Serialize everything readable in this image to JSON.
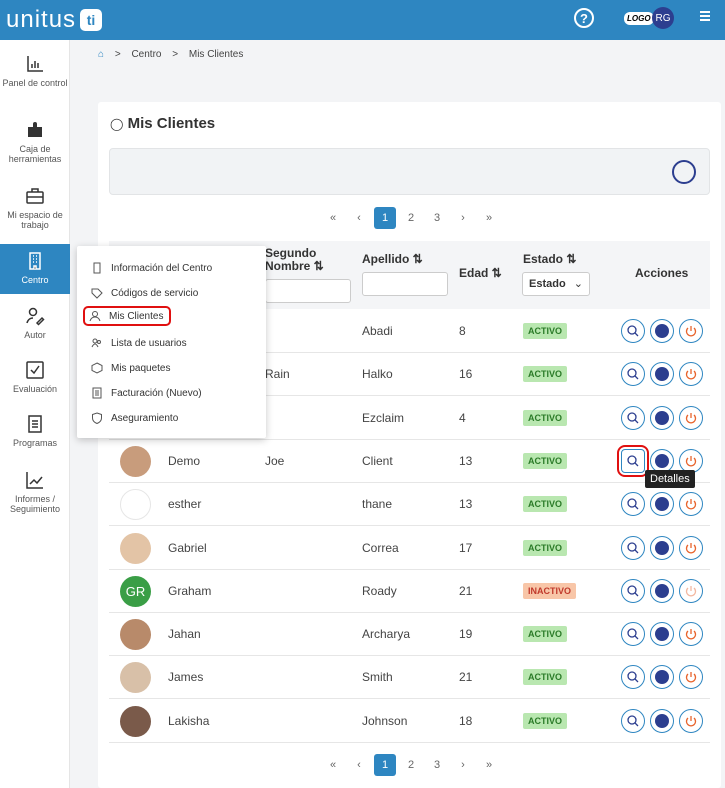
{
  "brand": {
    "name": "unitus",
    "badge": "ti"
  },
  "topbar": {
    "help": "?",
    "logo_label": "LOGO",
    "user_initials": "RG"
  },
  "sidebar": {
    "items": [
      {
        "label": "Panel de control",
        "icon": "chart-icon"
      },
      {
        "label": "Caja de herramientas",
        "icon": "puzzle-icon"
      },
      {
        "label": "Mi espacio de trabajo",
        "icon": "briefcase-icon"
      },
      {
        "label": "Centro",
        "icon": "building-icon",
        "active": true
      },
      {
        "label": "Autor",
        "icon": "author-icon"
      },
      {
        "label": "Evaluación",
        "icon": "check-icon"
      },
      {
        "label": "Programas",
        "icon": "document-icon"
      },
      {
        "label": "Informes / Seguimiento",
        "icon": "trend-icon"
      }
    ]
  },
  "breadcrumb": {
    "home": "⌂",
    "sep": ">",
    "items": [
      "Centro",
      "Mis Clientes"
    ]
  },
  "page": {
    "title": "Mis Clientes"
  },
  "pagination": {
    "first": "«",
    "prev": "‹",
    "pages": [
      "1",
      "2",
      "3"
    ],
    "next": "›",
    "last": "»",
    "current": "1"
  },
  "table": {
    "headers": {
      "middle_name": "Segundo Nombre ⇅",
      "last_name": "Apellido ⇅",
      "age": "Edad ⇅",
      "status": "Estado ⇅",
      "status_filter": "Estado",
      "actions": "Acciones"
    },
    "rows": [
      {
        "first": "",
        "middle": "",
        "last": "Abadi",
        "age": "8",
        "status": "ACTIVO",
        "active": true
      },
      {
        "first": "",
        "middle": "Rain",
        "last": "Halko",
        "age": "16",
        "status": "ACTIVO",
        "active": true
      },
      {
        "first": "",
        "middle": "",
        "last": "Ezclaim",
        "age": "4",
        "status": "ACTIVO",
        "active": true
      },
      {
        "first": "Demo",
        "middle": "Joe",
        "last": "Client",
        "age": "13",
        "status": "ACTIVO",
        "active": true
      },
      {
        "first": "esther",
        "middle": "",
        "last": "thane",
        "age": "13",
        "status": "ACTIVO",
        "active": true
      },
      {
        "first": "Gabriel",
        "middle": "",
        "last": "Correa",
        "age": "17",
        "status": "ACTIVO",
        "active": true
      },
      {
        "first": "Graham",
        "middle": "",
        "last": "Roady",
        "age": "21",
        "status": "INACTIVO",
        "active": false,
        "initials": "GR"
      },
      {
        "first": "Jahan",
        "middle": "",
        "last": "Archarya",
        "age": "19",
        "status": "ACTIVO",
        "active": true
      },
      {
        "first": "James",
        "middle": "",
        "last": "Smith",
        "age": "21",
        "status": "ACTIVO",
        "active": true
      },
      {
        "first": "Lakisha",
        "middle": "",
        "last": "Johnson",
        "age": "18",
        "status": "ACTIVO",
        "active": true
      }
    ]
  },
  "dropdown": {
    "items": [
      {
        "label": "Información del Centro",
        "icon": "building-icon"
      },
      {
        "label": "Códigos de servicio",
        "icon": "tag-icon"
      },
      {
        "label": "Mis Clientes",
        "icon": "user-icon",
        "active": true
      },
      {
        "label": "Lista de usuarios",
        "icon": "users-icon"
      },
      {
        "label": "Mis paquetes",
        "icon": "box-icon"
      },
      {
        "label": "Facturación (Nuevo)",
        "icon": "invoice-icon"
      },
      {
        "label": "Aseguramiento",
        "icon": "shield-icon"
      }
    ]
  },
  "tooltip": {
    "text": "Detalles"
  },
  "colors": {
    "primary": "#2e86c1",
    "navy": "#2c3e8f",
    "active_badge": "#b9e7b0",
    "inactive_badge": "#f8c6a8",
    "power": "#e8642c",
    "highlight": "#e01010"
  }
}
